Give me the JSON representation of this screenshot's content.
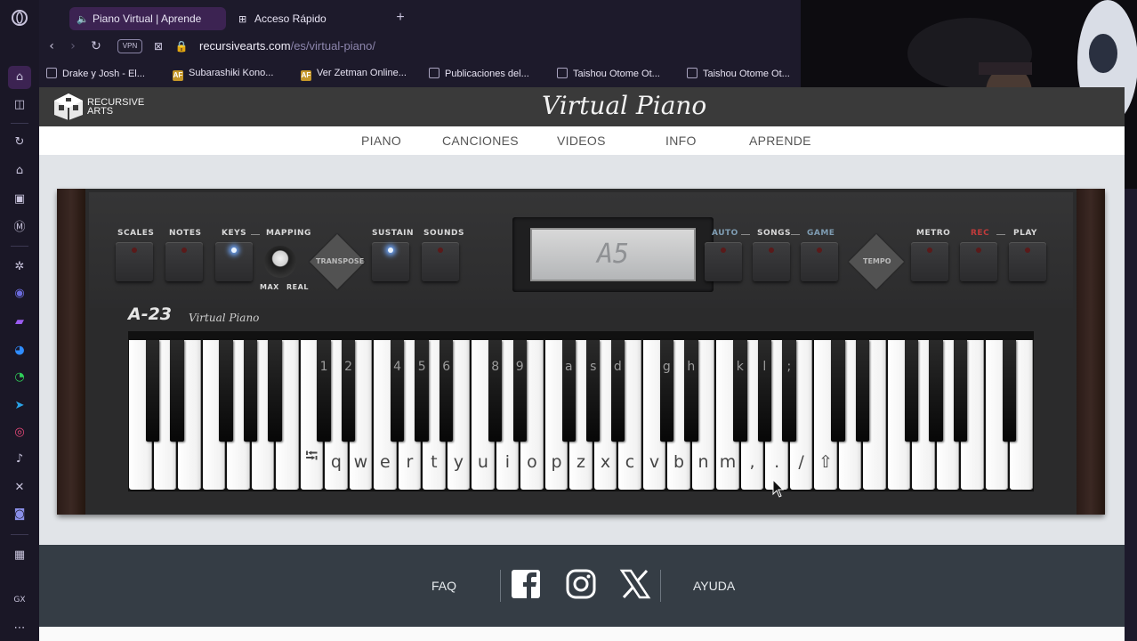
{
  "browser": {
    "tabs": [
      {
        "label": "Piano Virtual | Aprende",
        "icon": "speaker-icon",
        "active": true
      },
      {
        "label": "Acceso Rápido",
        "icon": "grid-icon",
        "active": false
      }
    ],
    "new_tab": "+",
    "vpn_label": "VPN",
    "url_host": "recursivearts.com",
    "url_path": "/es/virtual-piano/",
    "bookmarks": [
      {
        "label": "Drake y Josh - El...",
        "icon": "page-icon"
      },
      {
        "label": "Subarashiki Kono...",
        "icon": "af-icon"
      },
      {
        "label": "Ver Zetman Online...",
        "icon": "af-icon"
      },
      {
        "label": "Publicaciones del...",
        "icon": "page-icon"
      },
      {
        "label": "Taishou Otome Ot...",
        "icon": "page-icon"
      },
      {
        "label": "Taishou Otome Ot...",
        "icon": "page-icon"
      }
    ]
  },
  "site": {
    "logo_line1": "RECURSIVE",
    "logo_line2": "ARTS",
    "title": "Virtual Piano",
    "nav": [
      "PIANO",
      "CANCIONES",
      "VIDEOS",
      "INFO",
      "APRENDE"
    ]
  },
  "instrument": {
    "labels": {
      "scales": "SCALES",
      "notes": "NOTES",
      "keys": "KEYS",
      "mapping": "MAPPING",
      "max": "MAX",
      "real": "REAL",
      "transpose": "TRANSPOSE",
      "sustain": "SUSTAIN",
      "sounds": "SOUNDS",
      "auto": "AUTO",
      "songs": "SONGS",
      "game": "GAME",
      "tempo": "TEMPO",
      "metro": "METRO",
      "rec": "REC",
      "play": "PLAY"
    },
    "display": "A5",
    "model": "A-23",
    "model_sub": "Virtual Piano",
    "white_keys": [
      "",
      "",
      "",
      "",
      "",
      "",
      "",
      "⭾",
      "q",
      "w",
      "e",
      "r",
      "t",
      "y",
      "u",
      "i",
      "o",
      "p",
      "z",
      "x",
      "c",
      "v",
      "b",
      "n",
      "m",
      ",",
      ".",
      "/",
      "⇧",
      "",
      "",
      "",
      "",
      "",
      "",
      "",
      ""
    ],
    "black_keys": [
      "",
      "",
      "",
      "",
      "",
      "1",
      "2",
      "4",
      "5",
      "6",
      "8",
      "9",
      "a",
      "s",
      "d",
      "g",
      "h",
      "k",
      "l",
      ";",
      "",
      "",
      "",
      "",
      "",
      ""
    ]
  },
  "footer": {
    "faq": "FAQ",
    "help": "AYUDA",
    "social": [
      "facebook-icon",
      "instagram-icon",
      "x-icon"
    ]
  },
  "colors": {
    "browser_bg": "#1d1a2b",
    "active_tab": "#3c2352",
    "url_path": "#8d86ad",
    "led_on": "#6fa8ff",
    "rec_label": "#c23b3b",
    "footer_bg": "#353d45"
  }
}
